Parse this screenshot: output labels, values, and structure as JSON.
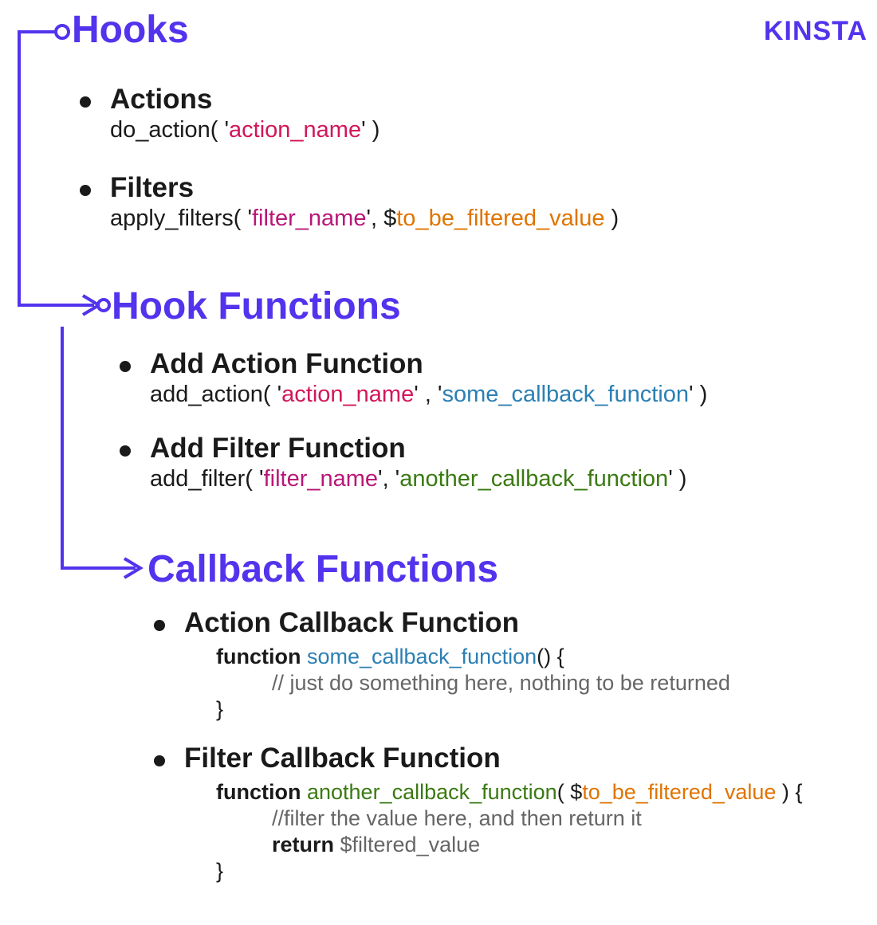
{
  "brand": "KINSTA",
  "sections": {
    "hooks": {
      "title": "Hooks",
      "actions": {
        "label": "Actions",
        "do_action_pre": "do_action( '",
        "action_name": "action_name",
        "do_action_post": "' )"
      },
      "filters": {
        "label": "Filters",
        "apply_pre": "apply_filters( '",
        "filter_name": "filter_name",
        "mid": "', $",
        "var": "to_be_filtered_value",
        "post": " )"
      }
    },
    "hookfn": {
      "title": "Hook Functions",
      "add_action": {
        "label": "Add Action Function",
        "pre": "add_action( '",
        "action_name": "action_name",
        "mid": "' , '",
        "cb": "some_callback_function",
        "post": "' )"
      },
      "add_filter": {
        "label": "Add Filter Function",
        "pre": "add_filter( '",
        "filter_name": "filter_name",
        "mid": "', '",
        "cb": "another_callback_function",
        "post": "' )"
      }
    },
    "cb": {
      "title": "Callback Functions",
      "action_cb": {
        "label": "Action Callback Function",
        "kw_function": "function ",
        "name": "some_callback_function",
        "sig": "() {",
        "comment": "// just do something here, nothing to be returned",
        "close": "}"
      },
      "filter_cb": {
        "label": "Filter Callback Function",
        "kw_function": "function ",
        "name": "another_callback_function",
        "sig_pre": "( $",
        "param": "to_be_filtered_value",
        "sig_post": " ) {",
        "comment": "//filter the value here, and then return it",
        "kw_return": "return ",
        "retvar": "$filtered_value",
        "close": "}"
      }
    }
  }
}
